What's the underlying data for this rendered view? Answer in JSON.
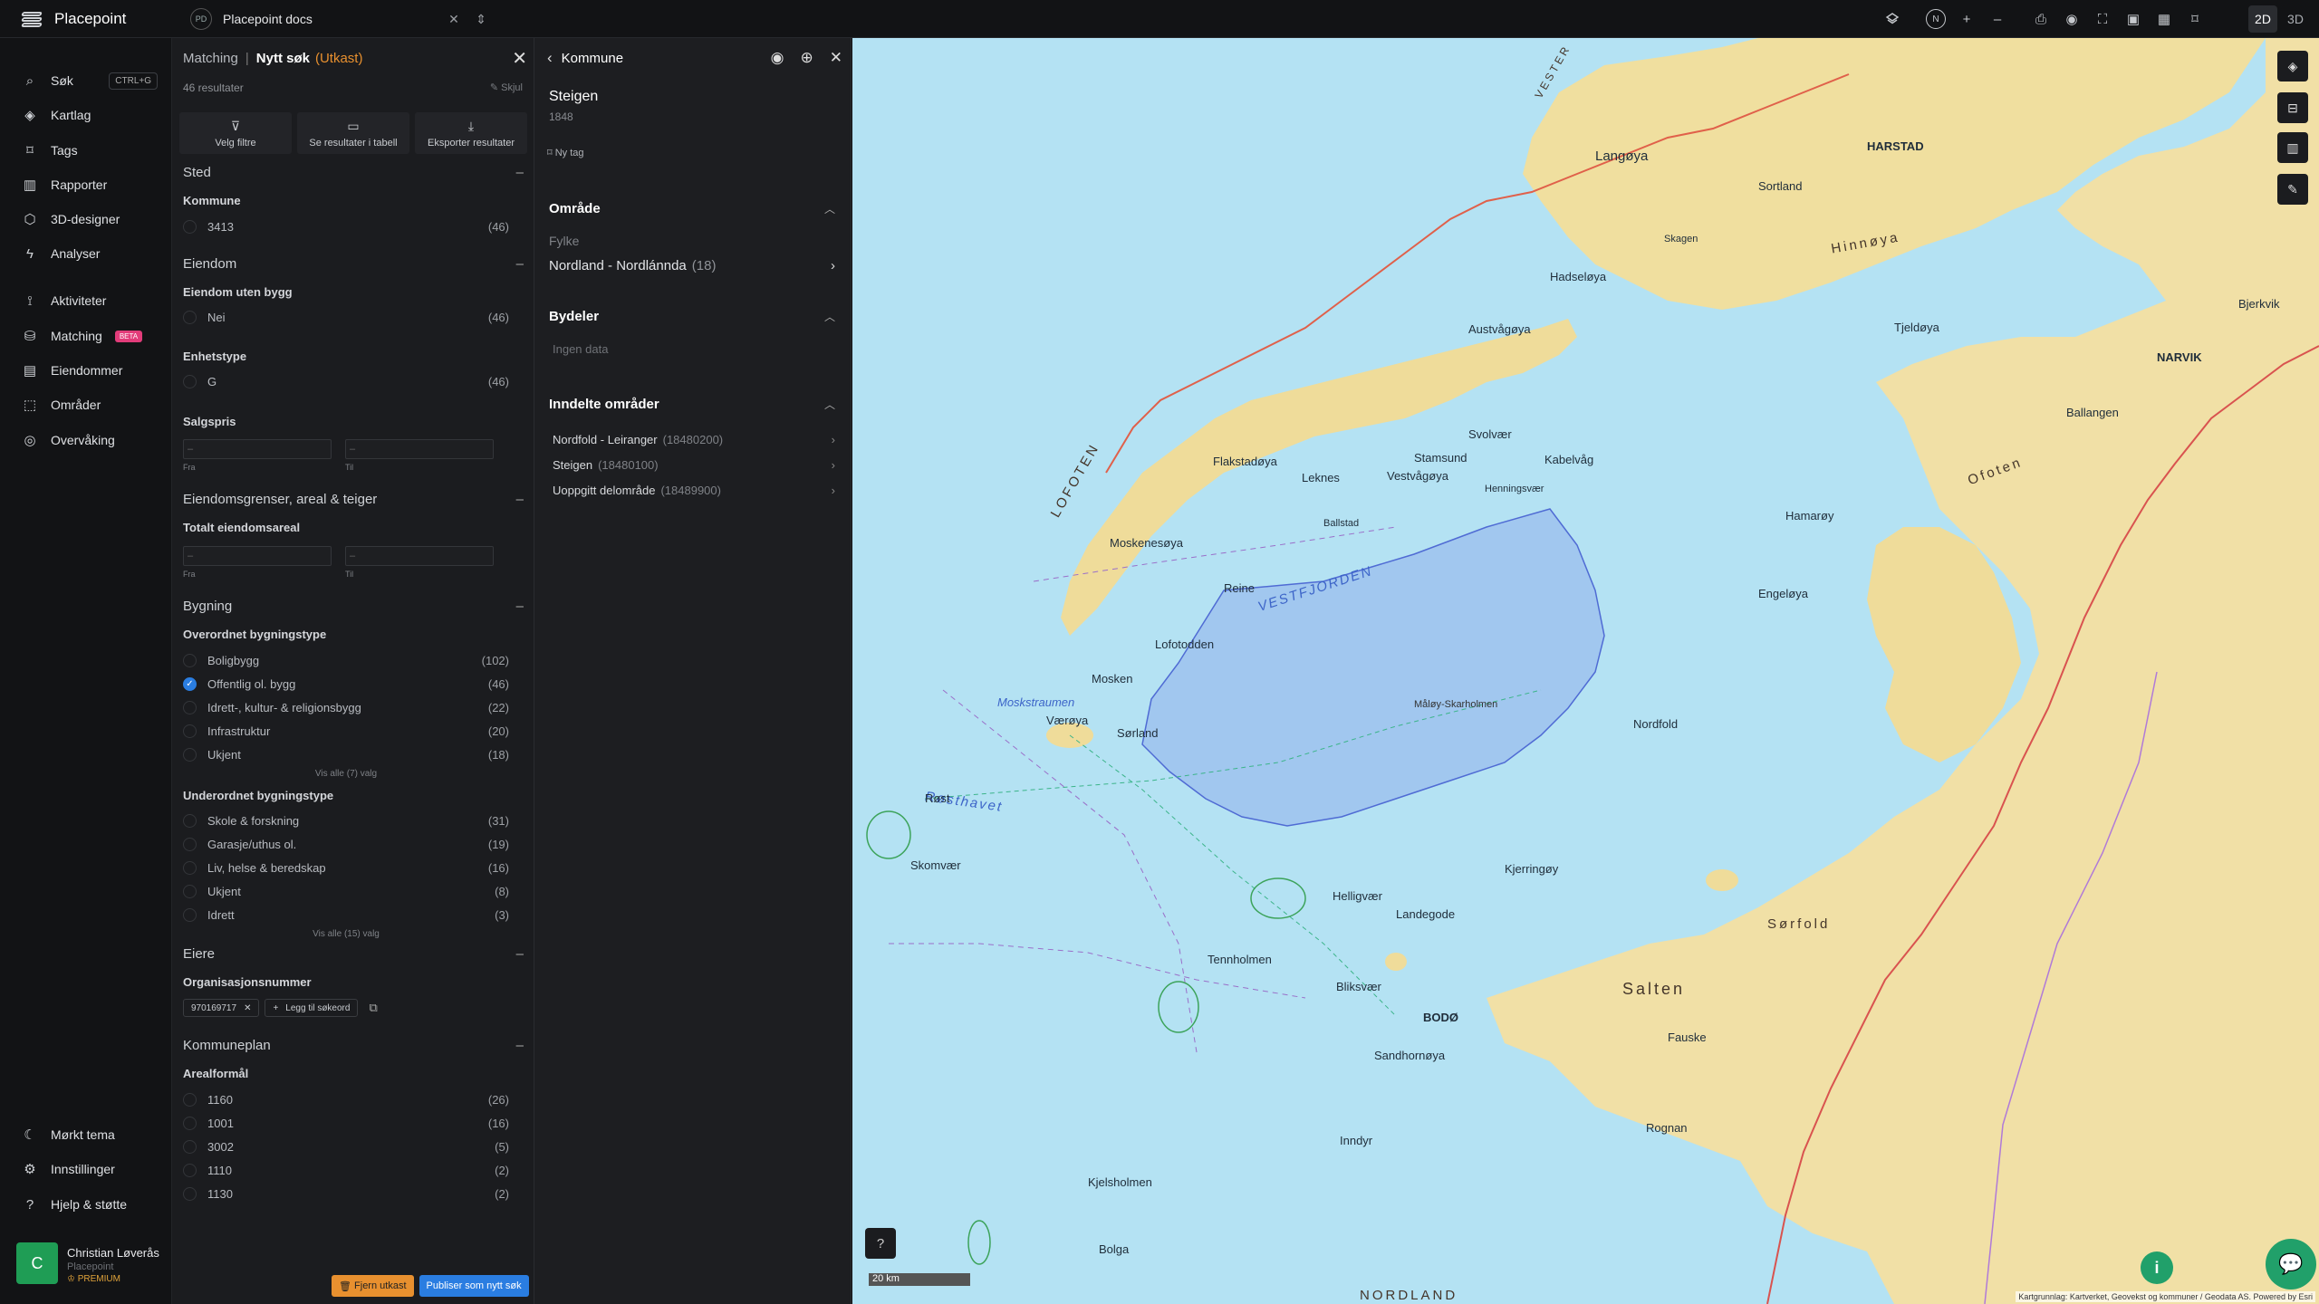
{
  "app": {
    "name": "Placepoint"
  },
  "workspace": {
    "badge": "PD",
    "name": "Placepoint docs"
  },
  "toolbar": {
    "compass": "N",
    "plus": "+",
    "minus": "–",
    "mode_2d": "2D",
    "mode_3d": "3D"
  },
  "nav": {
    "items": [
      {
        "label": "Søk",
        "kbd": "CTRL+G"
      },
      {
        "label": "Kartlag"
      },
      {
        "label": "Tags"
      },
      {
        "label": "Rapporter"
      },
      {
        "label": "3D-designer"
      },
      {
        "label": "Analyser"
      },
      {
        "label": "Aktiviteter"
      },
      {
        "label": "Matching",
        "badge": "BETA"
      },
      {
        "label": "Eiendommer"
      },
      {
        "label": "Områder"
      },
      {
        "label": "Overvåking"
      }
    ],
    "bottom": [
      {
        "label": "Mørkt tema"
      },
      {
        "label": "Innstillinger"
      },
      {
        "label": "Hjelp & støtte"
      }
    ],
    "user": {
      "initial": "C",
      "name": "Christian Løverås",
      "org": "Placepoint",
      "plan": "PREMIUM"
    }
  },
  "matching": {
    "breadcrumb": "Matching",
    "title": "Nytt søk",
    "draft": "(Utkast)",
    "results": "46 resultater",
    "hide": "Skjul",
    "actions": [
      "Velg filtre",
      "Se resultater i tabell",
      "Eksporter resultater"
    ],
    "sections": {
      "sted": "Sted",
      "eiendom": "Eiendom",
      "grenser": "Eiendomsgrenser, areal & teiger",
      "bygning": "Bygning",
      "eiere": "Eiere",
      "kommuneplan": "Kommuneplan"
    },
    "kommune": {
      "label": "Kommune",
      "options": [
        {
          "label": "3413",
          "count": "(46)"
        }
      ]
    },
    "uten_bygg": {
      "label": "Eiendom uten bygg",
      "options": [
        {
          "label": "Nei",
          "count": "(46)"
        }
      ]
    },
    "enhetstype": {
      "label": "Enhetstype",
      "options": [
        {
          "label": "G",
          "count": "(46)"
        }
      ]
    },
    "salgspris": {
      "label": "Salgspris",
      "from_placeholder": "–",
      "to_placeholder": "–",
      "from_label": "Fra",
      "to_label": "Til"
    },
    "areal": {
      "label": "Totalt eiendomsareal",
      "from_placeholder": "–",
      "to_placeholder": "–",
      "from_label": "Fra",
      "to_label": "Til"
    },
    "overordnet": {
      "label": "Overordnet bygningstype",
      "options": [
        {
          "label": "Boligbygg",
          "count": "(102)",
          "checked": false
        },
        {
          "label": "Offentlig ol. bygg",
          "count": "(46)",
          "checked": true
        },
        {
          "label": "Idrett-, kultur- & religionsbygg",
          "count": "(22)",
          "checked": false
        },
        {
          "label": "Infrastruktur",
          "count": "(20)",
          "checked": false
        },
        {
          "label": "Ukjent",
          "count": "(18)",
          "checked": false
        }
      ],
      "show_all": "Vis alle (7) valg"
    },
    "underordnet": {
      "label": "Underordnet bygningstype",
      "options": [
        {
          "label": "Skole & forskning",
          "count": "(31)"
        },
        {
          "label": "Garasje/uthus ol.",
          "count": "(19)"
        },
        {
          "label": "Liv, helse & beredskap",
          "count": "(16)"
        },
        {
          "label": "Ukjent",
          "count": "(8)"
        },
        {
          "label": "Idrett",
          "count": "(3)"
        }
      ],
      "show_all": "Vis alle (15) valg"
    },
    "orgnr": {
      "label": "Organisasjonsnummer",
      "chip": "970169717",
      "add": "Legg til søkeord"
    },
    "arealformal": {
      "label": "Arealformål",
      "options": [
        {
          "label": "1160",
          "count": "(26)"
        },
        {
          "label": "1001",
          "count": "(16)"
        },
        {
          "label": "3002",
          "count": "(5)"
        },
        {
          "label": "1110",
          "count": "(2)"
        },
        {
          "label": "1130",
          "count": "(2)"
        }
      ]
    },
    "footer": {
      "remove": "Fjern utkast",
      "publish": "Publiser som nytt søk"
    }
  },
  "kommune_panel": {
    "title": "Kommune",
    "name": "Steigen",
    "number": "1848",
    "tag": "Ny tag",
    "omrade": {
      "label": "Område",
      "fylke_label": "Fylke",
      "fylke": "Nordland - Nordlánnda",
      "fylke_count": "(18)"
    },
    "bydeler": {
      "label": "Bydeler",
      "empty": "Ingen data"
    },
    "inndelte": {
      "label": "Inndelte områder",
      "items": [
        {
          "name": "Nordfold - Leiranger",
          "id": "(18480200)"
        },
        {
          "name": "Steigen",
          "id": "(18480100)"
        },
        {
          "name": "Uoppgitt delområde",
          "id": "(18489900)"
        }
      ]
    }
  },
  "map": {
    "scale": "20 km",
    "attribution": "Kartgrunnlag: Kartverket, Geovekst og kommuner / Geodata AS. Powered by Esri",
    "labels": {
      "vestfjorden": "VESTFJORDEN",
      "lofoten": "LOFOTEN",
      "rosthavet": "Røsthavet",
      "moskstraumen": "Moskstraumen",
      "hinnoya": "Hinnøya",
      "ofoten": "Ofoten",
      "sorfold": "Sørfold",
      "salten": "Salten",
      "harstad": "HARSTAD",
      "narvik": "NARVIK",
      "bodo": "BODØ",
      "langoya": "Langøya",
      "hadseloya": "Hadseløya",
      "austvagoya": "Austvågøya",
      "vestvagoya": "Vestvågøya",
      "flakstadoya": "Flakstadøya",
      "moskenesoya": "Moskenesøya",
      "vaeroya": "Værøya",
      "rost": "Røst",
      "engeloya": "Engeløya",
      "hamaroy": "Hamarøy",
      "tjeldoya": "Tjeldøya",
      "sortland": "Sortland",
      "svolvaer": "Svolvær",
      "leknes": "Leknes",
      "mosken": "Mosken",
      "skomvaer": "Skomvær",
      "heligvaer": "Helligvær",
      "landegode": "Landegode",
      "tennholmen": "Tennholmen",
      "bliksvaer": "Bliksvær",
      "sandhornoya": "Sandhornøya",
      "inndyr": "Inndyr",
      "kjelholmen": "Kjelsholmen",
      "bolga": "Bolga",
      "fauske": "Fauske",
      "rognan": "Rognan",
      "nordfold": "Nordfold",
      "kjerringoy": "Kjerringøy",
      "maloy": "Måløy-Skarholmen",
      "lofotodden": "Lofotodden",
      "reine": "Reine",
      "sorland": "Sørland",
      "stamsund": "Stamsund",
      "kabelvag": "Kabelvåg",
      "henningsvaer": "Henningsvær",
      "ballstad": "Ballstad",
      "skagen": "Skagen",
      "bjerkvik": "Bjerkvik",
      "ballangen": "Ballangen",
      "sorreisa": "VESTER",
      "nordland": "NORDLAND"
    }
  }
}
